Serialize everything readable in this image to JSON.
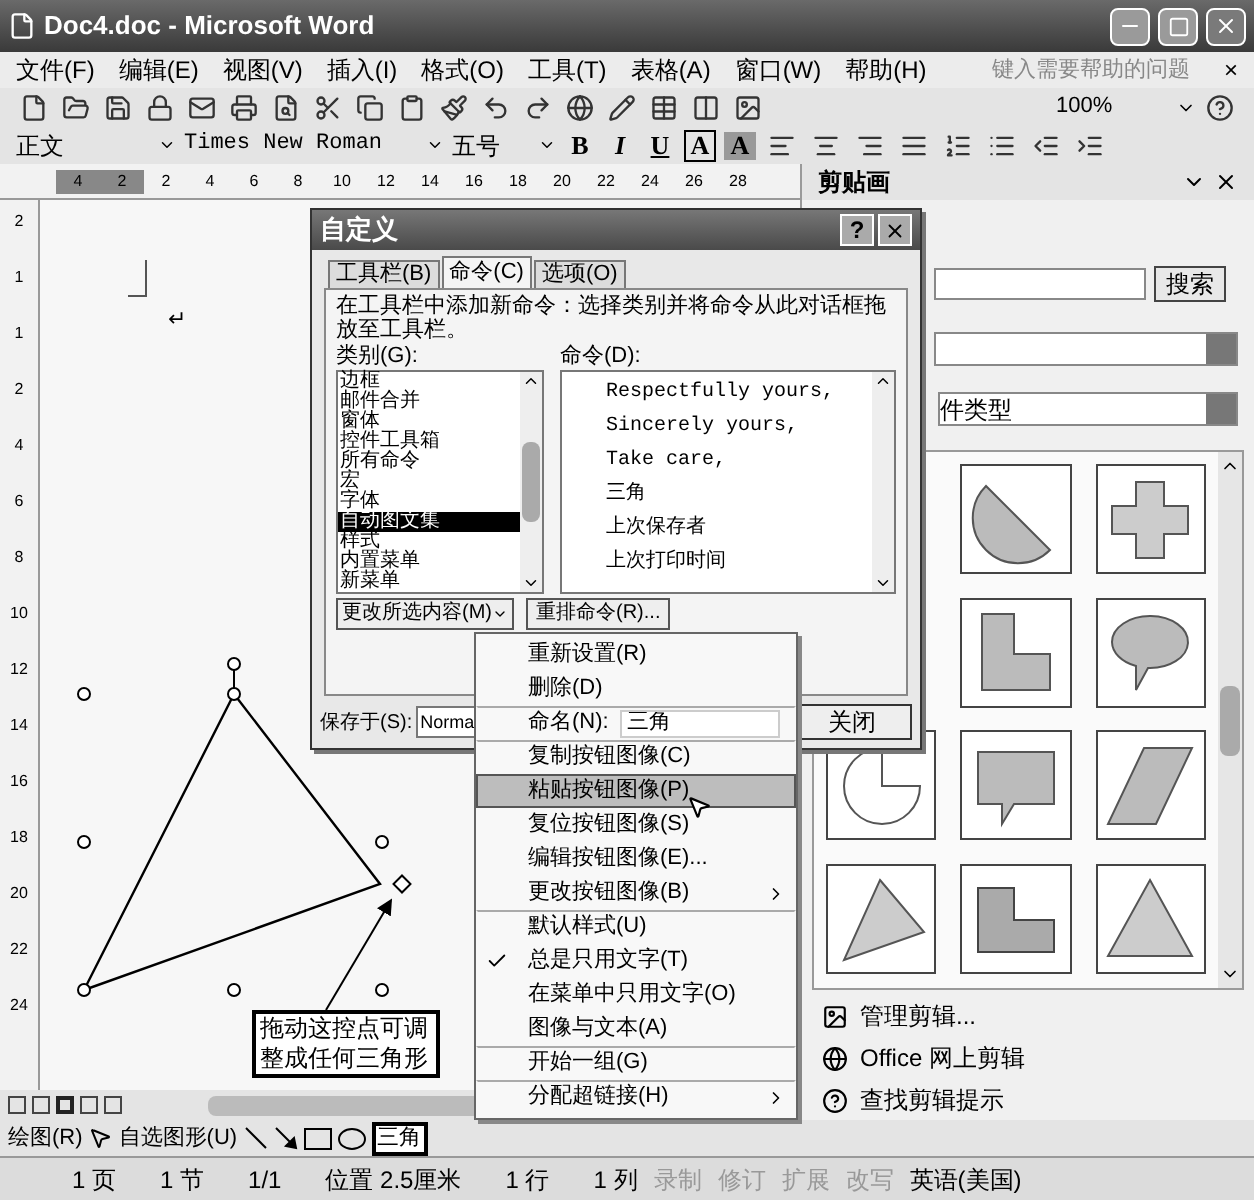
{
  "window": {
    "title": "Doc4.doc - Microsoft Word"
  },
  "menu_bar": {
    "items": [
      "文件(F)",
      "编辑(E)",
      "视图(V)",
      "插入(I)",
      "格式(O)",
      "工具(T)",
      "表格(A)",
      "窗口(W)",
      "帮助(H)"
    ],
    "help_box": {
      "placeholder": "键入需要帮助的问题"
    },
    "close": "×"
  },
  "standard_toolbar": {
    "zoom": "100%"
  },
  "formatting_toolbar": {
    "style": "正文",
    "font": "Times New Roman",
    "size": "五号",
    "letter_buttons": [
      "B",
      "I",
      "U",
      "A",
      "A"
    ]
  },
  "ruler": {
    "ticks": [
      "4",
      "2",
      "2",
      "4",
      "6",
      "8",
      "10",
      "12",
      "14",
      "16",
      "18",
      "20",
      "22",
      "24",
      "26",
      "28"
    ]
  },
  "vertical_ruler": {
    "ticks": [
      "2",
      "1",
      "1",
      "2",
      "4",
      "6",
      "8",
      "10",
      "12",
      "14",
      "16",
      "18",
      "20",
      "22",
      "24"
    ]
  },
  "document": {
    "paragraph_mark": "↵",
    "callout": "拖动这控点可调整成任何三角形"
  },
  "dialog": {
    "title": "自定义",
    "help": "?",
    "tabs": [
      {
        "label": "工具栏(B)",
        "selected": false
      },
      {
        "label": "命令(C)",
        "selected": true
      },
      {
        "label": "选项(O)",
        "selected": false
      }
    ],
    "description": "在工具栏中添加新命令：选择类别并将命令从此对话框拖放至工具栏。",
    "categories_label": "类别(G):",
    "categories": [
      {
        "label": "边框",
        "selected": false
      },
      {
        "label": "邮件合并",
        "selected": false
      },
      {
        "label": "窗体",
        "selected": false
      },
      {
        "label": "控件工具箱",
        "selected": false
      },
      {
        "label": "所有命令",
        "selected": false
      },
      {
        "label": "宏",
        "selected": false
      },
      {
        "label": "字体",
        "selected": false
      },
      {
        "label": "自动图文集",
        "selected": true
      },
      {
        "label": "样式",
        "selected": false
      },
      {
        "label": "内置菜单",
        "selected": false
      },
      {
        "label": "新菜单",
        "selected": false
      }
    ],
    "commands_label": "命令(D):",
    "commands": [
      "Respectfully yours,",
      "Sincerely yours,",
      "Take care,",
      "三角",
      "上次保存者",
      "上次打印时间"
    ],
    "modify_button": "更改所选内容(M)",
    "rearrange_button": "重排命令(R)...",
    "save_in_label": "保存于(S):",
    "save_in_value": "Norma",
    "close_button": "关闭"
  },
  "context_menu": {
    "items": [
      {
        "kind": "item",
        "label": "重新设置(R)",
        "separator_before": false,
        "checked": false,
        "selected": false,
        "submenu": false
      },
      {
        "kind": "item",
        "label": "删除(D)",
        "separator_before": false,
        "checked": false,
        "selected": false,
        "submenu": false
      },
      {
        "kind": "field",
        "label": "命名(N):",
        "value": "三角",
        "separator_before": true,
        "checked": false,
        "selected": false,
        "submenu": false
      },
      {
        "kind": "item",
        "label": "复制按钮图像(C)",
        "separator_before": true,
        "checked": false,
        "selected": false,
        "submenu": false
      },
      {
        "kind": "item",
        "label": "粘贴按钮图像(P)",
        "separator_before": false,
        "checked": false,
        "selected": true,
        "submenu": false
      },
      {
        "kind": "item",
        "label": "复位按钮图像(S)",
        "separator_before": false,
        "checked": false,
        "selected": false,
        "submenu": false
      },
      {
        "kind": "item",
        "label": "编辑按钮图像(E)...",
        "separator_before": false,
        "checked": false,
        "selected": false,
        "submenu": false
      },
      {
        "kind": "item",
        "label": "更改按钮图像(B)",
        "separator_before": false,
        "checked": false,
        "selected": false,
        "submenu": true
      },
      {
        "kind": "item",
        "label": "默认样式(U)",
        "separator_before": true,
        "checked": false,
        "selected": false,
        "submenu": false
      },
      {
        "kind": "item",
        "label": "总是只用文字(T)",
        "separator_before": false,
        "checked": true,
        "selected": false,
        "submenu": false
      },
      {
        "kind": "item",
        "label": "在菜单中只用文字(O)",
        "separator_before": false,
        "checked": false,
        "selected": false,
        "submenu": false
      },
      {
        "kind": "item",
        "label": "图像与文本(A)",
        "separator_before": false,
        "checked": false,
        "selected": false,
        "submenu": false
      },
      {
        "kind": "item",
        "label": "开始一组(G)",
        "separator_before": true,
        "checked": false,
        "selected": false,
        "submenu": false
      },
      {
        "kind": "item",
        "label": "分配超链接(H)",
        "separator_before": true,
        "checked": false,
        "selected": false,
        "submenu": true
      }
    ]
  },
  "task_pane": {
    "title": "剪贴画",
    "search_button": "搜索",
    "file_type_dropdown": "件类型",
    "links": [
      "管理剪辑...",
      "Office 网上剪辑",
      "查找剪辑提示"
    ]
  },
  "drawing_toolbar": {
    "draw_menu": "绘图(R)",
    "autoshapes_menu": "自选图形(U)",
    "shape_button": "三角"
  },
  "status_bar": {
    "items": [
      "1 页",
      "1 节",
      "1/1",
      "位置 2.5厘米",
      "1 行",
      "1 列"
    ],
    "modes": [
      {
        "label": "录制",
        "disabled": true
      },
      {
        "label": "修订",
        "disabled": true
      },
      {
        "label": "扩展",
        "disabled": true
      },
      {
        "label": "改写",
        "disabled": true
      },
      {
        "label": "英语(美国)",
        "disabled": false
      }
    ]
  }
}
